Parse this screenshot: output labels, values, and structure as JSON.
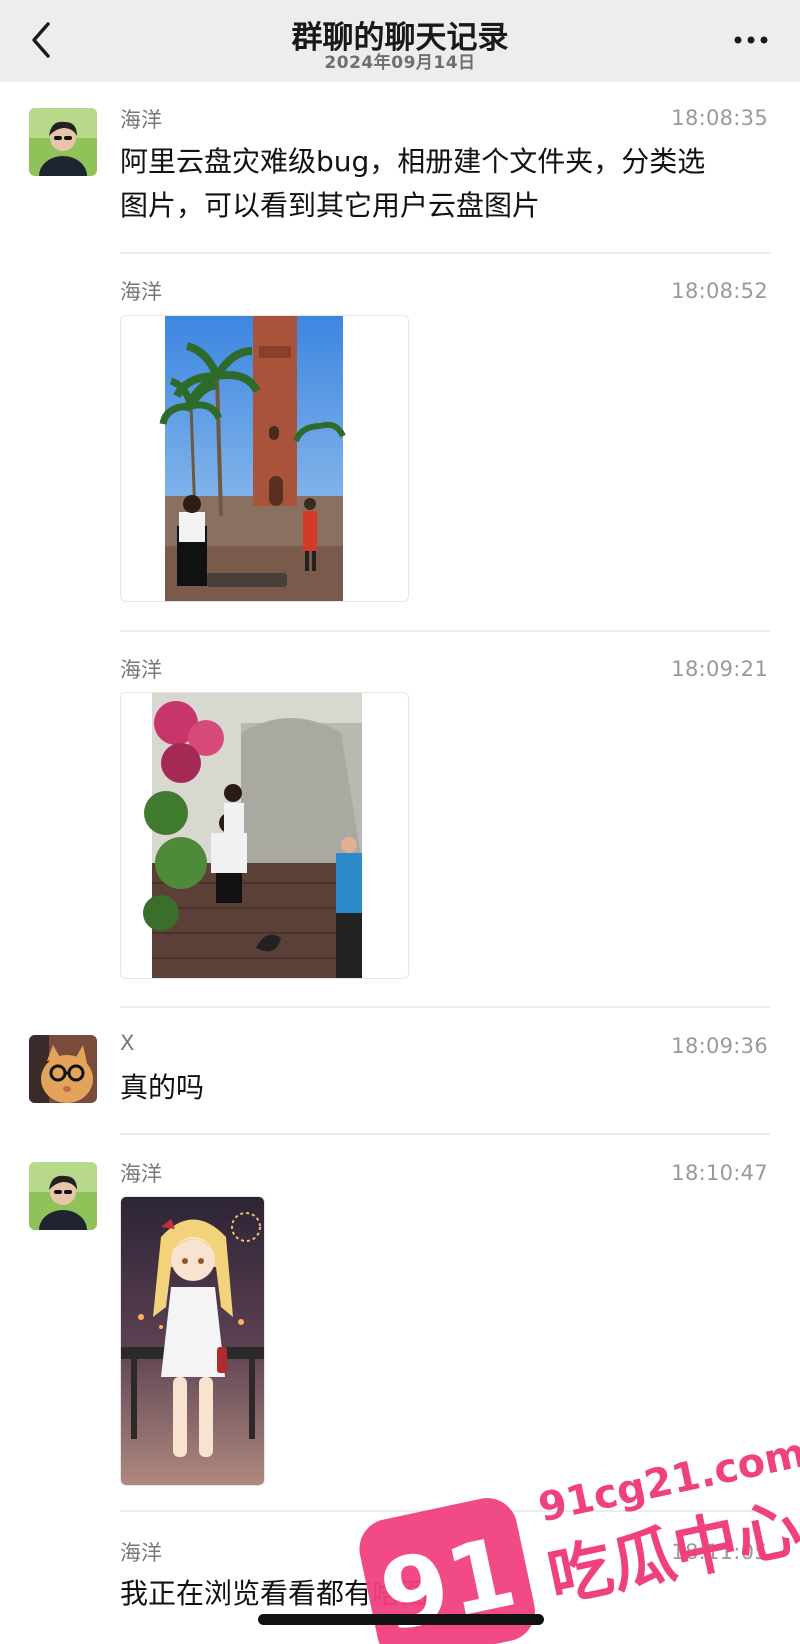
{
  "header": {
    "title": "群聊的聊天记录",
    "date": "2024年09月14日"
  },
  "messages": [
    {
      "sender": "海洋",
      "time": "18:08:35",
      "text_line1": "阿里云盘灾难级bug，相册建个文件夹，分类选",
      "text_line2": "图片，可以看到其它用户云盘图片"
    },
    {
      "sender": "海洋",
      "time": "18:08:52"
    },
    {
      "sender": "海洋",
      "time": "18:09:21"
    },
    {
      "sender": "X",
      "time": "18:09:36",
      "text_line1": "真的吗"
    },
    {
      "sender": "海洋",
      "time": "18:10:47"
    },
    {
      "sender": "海洋",
      "time": "18:11:05",
      "text_line1": "我正在浏览看看都有啥图。"
    }
  ],
  "watermark": {
    "url": "91cg21.com",
    "logo_number": "91",
    "name": "吃瓜中心"
  },
  "colors": {
    "header_bg": "#ededed",
    "watermark_pink": "#f0407f"
  }
}
